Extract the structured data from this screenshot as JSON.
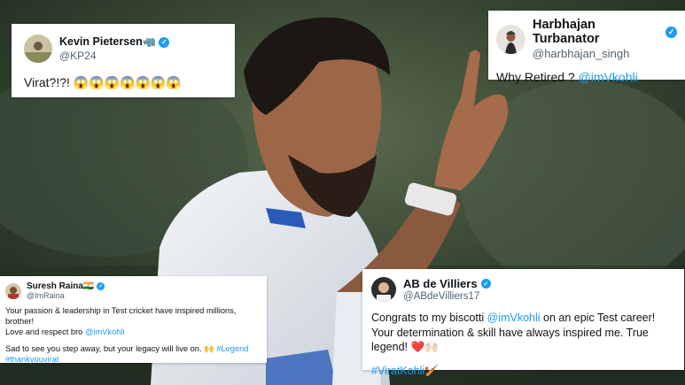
{
  "colors": {
    "link": "#1d9bf0",
    "verified": "#1d9bf0",
    "handle": "#536471",
    "text": "#0f1419"
  },
  "background": {
    "icon": "cricketer-photo"
  },
  "tweets": {
    "kp": {
      "name": "Kevin Pietersen🦏",
      "handle": "@KP24",
      "text": "Virat?!?! 😱😱😱😱😱😱😱"
    },
    "hb": {
      "name": "Harbhajan Turbanator",
      "handle": "@harbhajan_singh",
      "text": "Why Retired ? ",
      "mention": "@imVkohli"
    },
    "sr": {
      "name": "Suresh Raina🇮🇳",
      "handle": "@ImRaina",
      "line1": "Your passion & leadership in Test cricket have inspired millions, brother!",
      "line2": "Love and respect bro ",
      "mention": "@imVkohli",
      "line3": "Sad to see you step away, but your legacy will live on. 🙌 ",
      "tag1": "#Legend",
      "tag2": "#thankyouvirat"
    },
    "ab": {
      "name": "AB de Villiers",
      "handle": "@ABdeVilliers17",
      "text_pre": "Congrats to my biscotti ",
      "mention": "@imVkohli",
      "text_post": " on an epic Test career! Your determination & skill have always inspired me. True legend! ❤️🙌🏻",
      "tag": "#ViratKohli🏏"
    }
  }
}
